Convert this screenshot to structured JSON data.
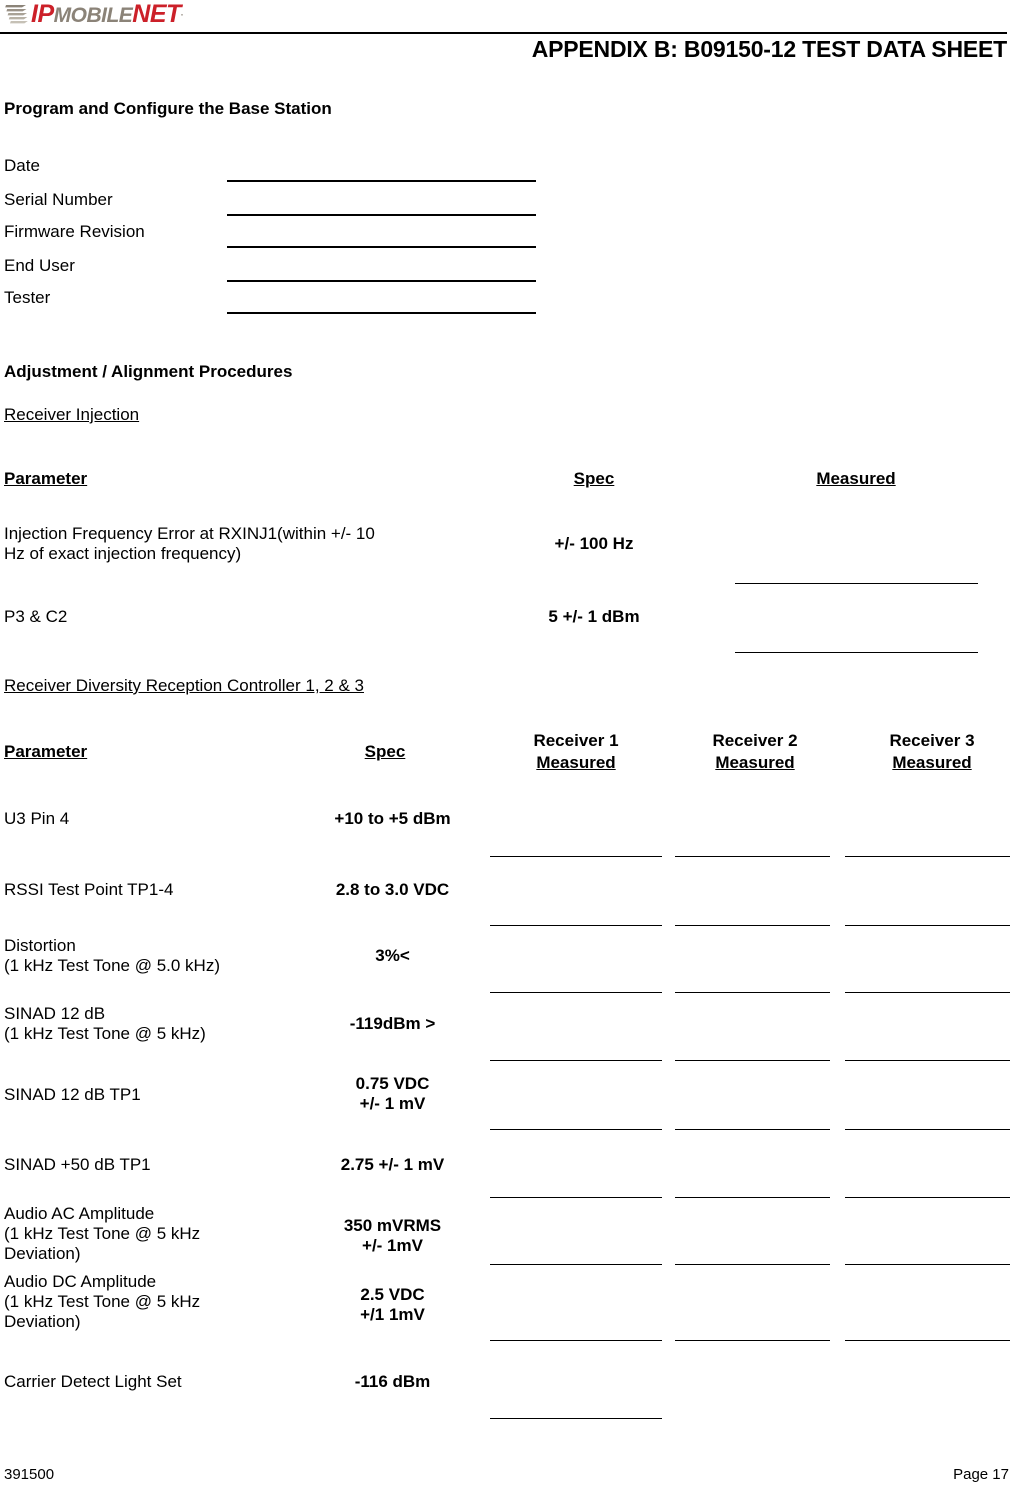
{
  "header": {
    "logo": {
      "part1": "IP",
      "part2": "MOBILE",
      "part3": "NET",
      "trademark": "."
    },
    "title": "APPENDIX B:  B09150-12 TEST DATA SHEET"
  },
  "section_program": {
    "heading": "Program and Configure the Base Station",
    "fields": [
      {
        "label": "Date",
        "value": ""
      },
      {
        "label": "Serial Number",
        "value": ""
      },
      {
        "label": "Firmware Revision",
        "value": ""
      },
      {
        "label": "End User",
        "value": ""
      },
      {
        "label": "Tester",
        "value": ""
      }
    ]
  },
  "section_adjustment": {
    "heading": "Adjustment / Alignment Procedures",
    "subsection_injection": {
      "heading": "Receiver Injection",
      "columns": [
        "Parameter",
        "Spec",
        "Measured"
      ],
      "rows": [
        {
          "parameter_line1": "Injection Frequency Error at RXINJ1(within +/- 10",
          "parameter_line2": "Hz of exact injection frequency)",
          "spec": "+/- 100 Hz",
          "measured": ""
        },
        {
          "parameter_line1": "P3 & C2",
          "parameter_line2": "",
          "spec": "5 +/- 1 dBm",
          "measured": ""
        }
      ]
    },
    "subsection_diversity": {
      "heading": "Receiver Diversity Reception Controller 1, 2 & 3",
      "columns": [
        "Parameter",
        "Spec",
        "Receiver 1\nMeasured",
        "Receiver 2\nMeasured",
        "Receiver 3\nMeasured"
      ],
      "column_headers": {
        "parameter": "Parameter",
        "spec": "Spec",
        "rx1_line1": "Receiver 1",
        "rx1_line2": "Measured",
        "rx2_line1": "Receiver 2",
        "rx2_line2": "Measured",
        "rx3_line1": "Receiver 3",
        "rx3_line2": "Measured"
      },
      "rows": [
        {
          "parameter_line1": "U3 Pin 4",
          "parameter_line2": "",
          "parameter_line3": "",
          "spec_line1": "+10 to +5 dBm",
          "spec_line2": "",
          "rx1": "",
          "rx2": "",
          "rx3": ""
        },
        {
          "parameter_line1": "RSSI Test Point TP1-4",
          "parameter_line2": "",
          "parameter_line3": "",
          "spec_line1": "2.8 to 3.0 VDC",
          "spec_line2": "",
          "rx1": "",
          "rx2": "",
          "rx3": ""
        },
        {
          "parameter_line1": "Distortion",
          "parameter_line2": "(1 kHz Test Tone @ 5.0 kHz)",
          "parameter_line3": "",
          "spec_line1": "3%<",
          "spec_line2": "",
          "rx1": "",
          "rx2": "",
          "rx3": ""
        },
        {
          "parameter_line1": "SINAD 12 dB",
          "parameter_line2": "(1 kHz Test Tone @ 5 kHz)",
          "parameter_line3": "",
          "spec_line1": "-119dBm >",
          "spec_line2": "",
          "rx1": "",
          "rx2": "",
          "rx3": ""
        },
        {
          "parameter_line1": "SINAD 12 dB TP1",
          "parameter_line2": "",
          "parameter_line3": "",
          "spec_line1": "0.75 VDC",
          "spec_line2": "+/- 1 mV",
          "rx1": "",
          "rx2": "",
          "rx3": ""
        },
        {
          "parameter_line1": "SINAD +50 dB TP1",
          "parameter_line2": "",
          "parameter_line3": "",
          "spec_line1": "2.75 +/- 1 mV",
          "spec_line2": "",
          "rx1": "",
          "rx2": "",
          "rx3": ""
        },
        {
          "parameter_line1": "Audio AC Amplitude",
          "parameter_line2": "(1 kHz Test Tone @ 5 kHz",
          "parameter_line3": "Deviation)",
          "spec_line1": "350 mVRMS",
          "spec_line2": "+/- 1mV",
          "rx1": "",
          "rx2": "",
          "rx3": ""
        },
        {
          "parameter_line1": "Audio DC Amplitude",
          "parameter_line2": "(1 kHz Test Tone @ 5 kHz",
          "parameter_line3": "Deviation)",
          "spec_line1": "2.5 VDC",
          "spec_line2": "+/1 1mV",
          "rx1": "",
          "rx2": "",
          "rx3": ""
        },
        {
          "parameter_line1": "Carrier Detect Light Set",
          "parameter_line2": "",
          "parameter_line3": "",
          "spec_line1": "-116 dBm",
          "spec_line2": "",
          "rx1": "",
          "rx2": "",
          "rx3": ""
        }
      ]
    }
  },
  "footer": {
    "document_number": "391500",
    "page_label": "Page 17"
  }
}
